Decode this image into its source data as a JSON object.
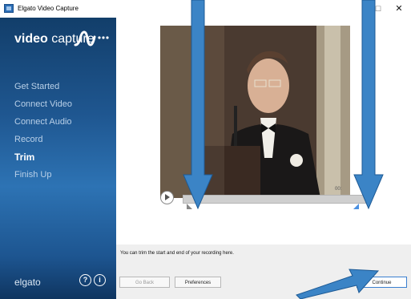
{
  "window": {
    "title": "Elgato Video Capture",
    "max_glyph": "☐",
    "close_glyph": "✕"
  },
  "brand": {
    "bold": "video",
    "light": "capture"
  },
  "nav": {
    "items": [
      {
        "label": "Get Started"
      },
      {
        "label": "Connect Video"
      },
      {
        "label": "Connect Audio"
      },
      {
        "label": "Record"
      },
      {
        "label": "Trim",
        "active": true
      },
      {
        "label": "Finish Up"
      }
    ]
  },
  "sidebar_footer": {
    "logo": "elgato",
    "help_glyph": "?",
    "info_glyph": "i"
  },
  "player": {
    "timecode": "00:",
    "progress": 0
  },
  "footer": {
    "hint": "You can trim the start and end of your recording here.",
    "back_label": "Go Back",
    "prefs_label": "Preferences",
    "continue_label": "Continue"
  },
  "colors": {
    "sidebar_top": "#123e6a",
    "sidebar_mid": "#2d73b4",
    "accent": "#4a90e2",
    "callout_arrow": "#3b84c6"
  }
}
